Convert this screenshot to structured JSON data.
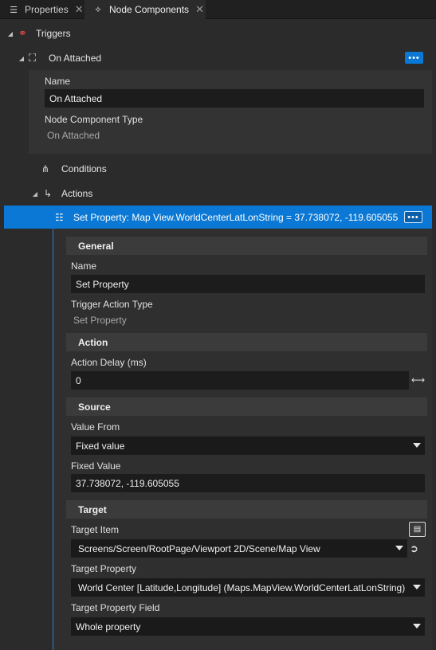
{
  "tabs": [
    {
      "label": "Properties",
      "icon": "properties-icon",
      "close": "✕"
    },
    {
      "label": "Node Components",
      "icon": "node-components-icon",
      "close": "✕"
    }
  ],
  "tree": {
    "triggers_label": "Triggers",
    "on_attached_label": "On Attached",
    "conditions_label": "Conditions",
    "actions_label": "Actions",
    "selected_action_label": "Set Property: Map View.WorldCenterLatLonString = 37.738072, -119.605055",
    "more_label": "•••"
  },
  "on_attached_panel": {
    "name_label": "Name",
    "name_value": "On Attached",
    "type_label": "Node Component Type",
    "type_value": "On Attached"
  },
  "general": {
    "header": "General",
    "name_label": "Name",
    "name_value": "Set Property",
    "type_label": "Trigger Action Type",
    "type_value": "Set Property"
  },
  "action": {
    "header": "Action",
    "delay_label": "Action Delay (ms)",
    "delay_value": "0"
  },
  "source": {
    "header": "Source",
    "value_from_label": "Value From",
    "value_from_value": "Fixed value",
    "fixed_value_label": "Fixed Value",
    "fixed_value_value": "37.738072, -119.605055"
  },
  "target": {
    "header": "Target",
    "item_label": "Target Item",
    "item_value": "Screens/Screen/RootPage/Viewport 2D/Scene/Map View",
    "property_label": "Target Property",
    "property_value": "World Center [Latitude,Longitude] (Maps.MapView.WorldCenterLatLonString)",
    "field_label": "Target Property Field",
    "field_value": "Whole property"
  },
  "colors": {
    "accent": "#0a78d4",
    "background": "#2b2b2b",
    "panel": "#333333",
    "field": "#1c1c1c",
    "triggers_icon": "#e04848"
  }
}
